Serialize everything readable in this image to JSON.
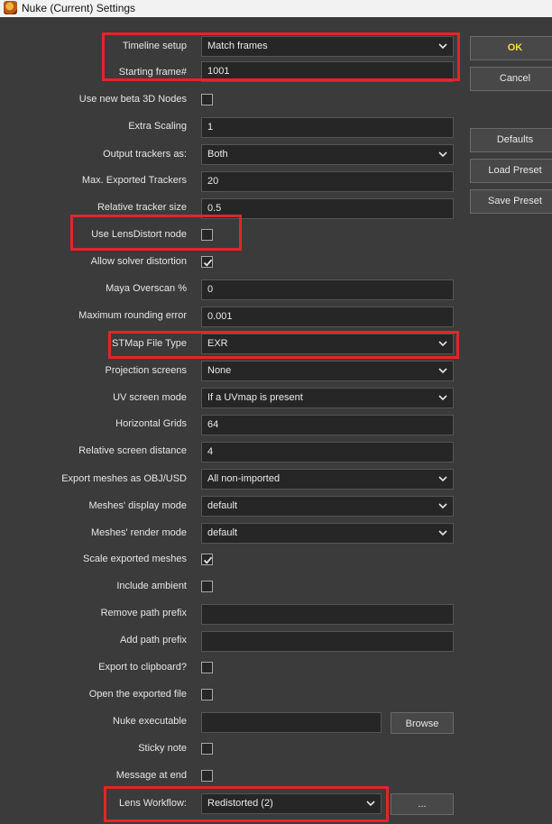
{
  "window": {
    "title": "Nuke (Current) Settings"
  },
  "buttons": {
    "ok": "OK",
    "cancel": "Cancel",
    "defaults": "Defaults",
    "load_preset": "Load Preset",
    "save_preset": "Save Preset",
    "browse": "Browse",
    "ellipsis": "..."
  },
  "fields": {
    "timeline_setup": {
      "label": "Timeline setup",
      "value": "Match frames"
    },
    "starting_frame": {
      "label": "Starting frame#",
      "value": "1001"
    },
    "beta_3d_nodes": {
      "label": "Use new beta 3D Nodes",
      "checked": false
    },
    "extra_scaling": {
      "label": "Extra Scaling",
      "value": "1"
    },
    "output_trackers": {
      "label": "Output trackers as:",
      "value": "Both"
    },
    "max_trackers": {
      "label": "Max. Exported Trackers",
      "value": "20"
    },
    "tracker_size": {
      "label": "Relative tracker size",
      "value": "0.5"
    },
    "lensdistort": {
      "label": "Use LensDistort node",
      "checked": false
    },
    "solver_distortion": {
      "label": "Allow solver distortion",
      "checked": true
    },
    "maya_overscan": {
      "label": "Maya Overscan %",
      "value": "0"
    },
    "rounding_error": {
      "label": "Maximum rounding error",
      "value": "0.001"
    },
    "stmap_type": {
      "label": "STMap File Type",
      "value": "EXR"
    },
    "projection_screens": {
      "label": "Projection screens",
      "value": "None"
    },
    "uv_screen_mode": {
      "label": "UV screen mode",
      "value": "If a UVmap is present"
    },
    "horizontal_grids": {
      "label": "Horizontal Grids",
      "value": "64"
    },
    "screen_distance": {
      "label": "Relative screen distance",
      "value": "4"
    },
    "export_meshes": {
      "label": "Export meshes as OBJ/USD",
      "value": "All non-imported"
    },
    "display_mode": {
      "label": "Meshes' display mode",
      "value": "default"
    },
    "render_mode": {
      "label": "Meshes' render mode",
      "value": "default"
    },
    "scale_meshes": {
      "label": "Scale exported meshes",
      "checked": true
    },
    "include_ambient": {
      "label": "Include ambient",
      "checked": false
    },
    "remove_prefix": {
      "label": "Remove path prefix",
      "value": ""
    },
    "add_prefix": {
      "label": "Add path prefix",
      "value": ""
    },
    "export_clipboard": {
      "label": "Export to clipboard?",
      "checked": false
    },
    "open_exported": {
      "label": "Open the exported file",
      "checked": false
    },
    "nuke_executable": {
      "label": "Nuke executable",
      "value": ""
    },
    "sticky_note": {
      "label": "Sticky note",
      "checked": false
    },
    "message_at_end": {
      "label": "Message at end",
      "checked": false
    },
    "lens_workflow": {
      "label": "Lens Workflow:",
      "value": "Redistorted (2)"
    }
  },
  "colors": {
    "highlight": "#e1262a",
    "ok_text": "#f2e033",
    "panel_bg": "#3b3b3b",
    "field_bg": "#262626"
  },
  "icons": {
    "dropdown": "chevron-down-icon",
    "checkbox_mark": "check-icon",
    "app": "nuke-app-icon"
  }
}
